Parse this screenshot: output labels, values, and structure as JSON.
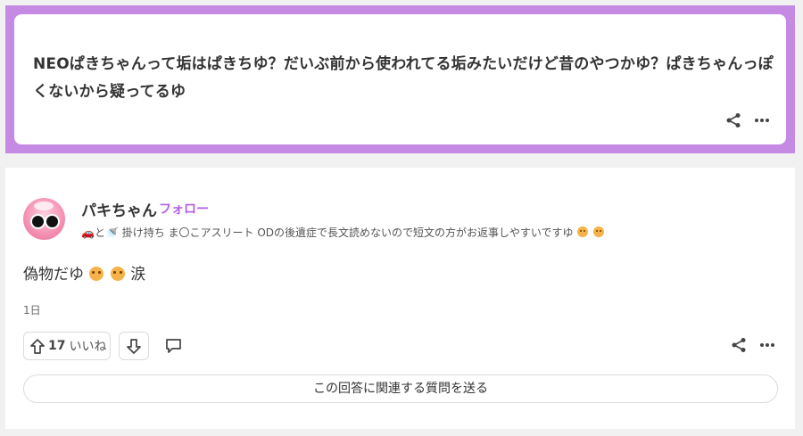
{
  "question": {
    "text": "NEOぱきちゃんって垢はぱきちゆ？だいぶ前から使われてる垢みたいだけど昔のやつかゆ？ぱきちゃんっぽくないから疑ってるゆ",
    "share_icon": "share-icon",
    "more_icon": "more-dots-icon",
    "highlight_color": "#c58ae3"
  },
  "answer": {
    "user_name": "パキちゃん",
    "follow_label": "フォロー",
    "follow_color": "#b35ee0",
    "bio": {
      "pre": "🚗と🚿 掛け持ち ま〇こアスリート ODの後遺症で長文読めないので短文の方がお返事しやすいですゆ",
      "emoji_icon": "crying-face-icon"
    },
    "body": {
      "pre": "偽物だゆ",
      "post": "涙"
    },
    "time": "1日",
    "vote_count": "17",
    "vote_label": "いいね",
    "related_question_label": "この回答に関連する質問を送る"
  }
}
